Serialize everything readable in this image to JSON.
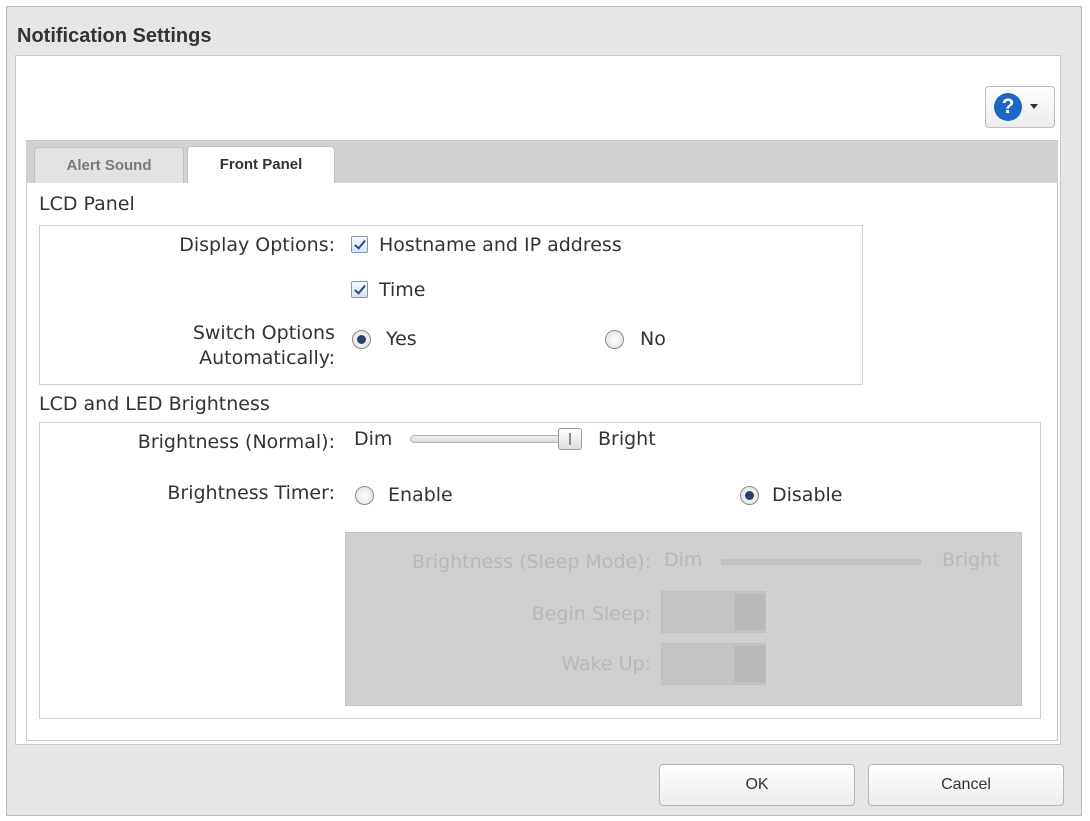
{
  "dialog": {
    "title": "Notification Settings",
    "help_icon": "question-circle-icon",
    "help_glyph": "?",
    "accent_color": "#1c66c6"
  },
  "tabs": [
    {
      "label": "Alert Sound",
      "active": false
    },
    {
      "label": "Front Panel",
      "active": true
    }
  ],
  "lcd_panel": {
    "section_title": "LCD Panel",
    "display_options_label": "Display Options:",
    "hostname_ip_label": "Hostname and IP address",
    "hostname_ip_checked": true,
    "time_label": "Time",
    "time_checked": true,
    "switch_label_line1": "Switch Options",
    "switch_label_line2": "Automatically:",
    "yes_label": "Yes",
    "no_label": "No",
    "switch_selected": "Yes"
  },
  "brightness": {
    "section_title": "LCD and LED Brightness",
    "normal_label": "Brightness (Normal):",
    "dim_label": "Dim",
    "bright_label": "Bright",
    "normal_level": 1.0,
    "timer_label": "Brightness Timer:",
    "enable_label": "Enable",
    "disable_label": "Disable",
    "timer_selected": "Disable",
    "sleep": {
      "sleep_mode_label": "Brightness (Sleep Mode):",
      "dim_label": "Dim",
      "bright_label": "Bright",
      "begin_sleep_label": "Begin Sleep:",
      "wake_up_label": "Wake Up:"
    }
  },
  "footer": {
    "ok_label": "OK",
    "cancel_label": "Cancel"
  }
}
